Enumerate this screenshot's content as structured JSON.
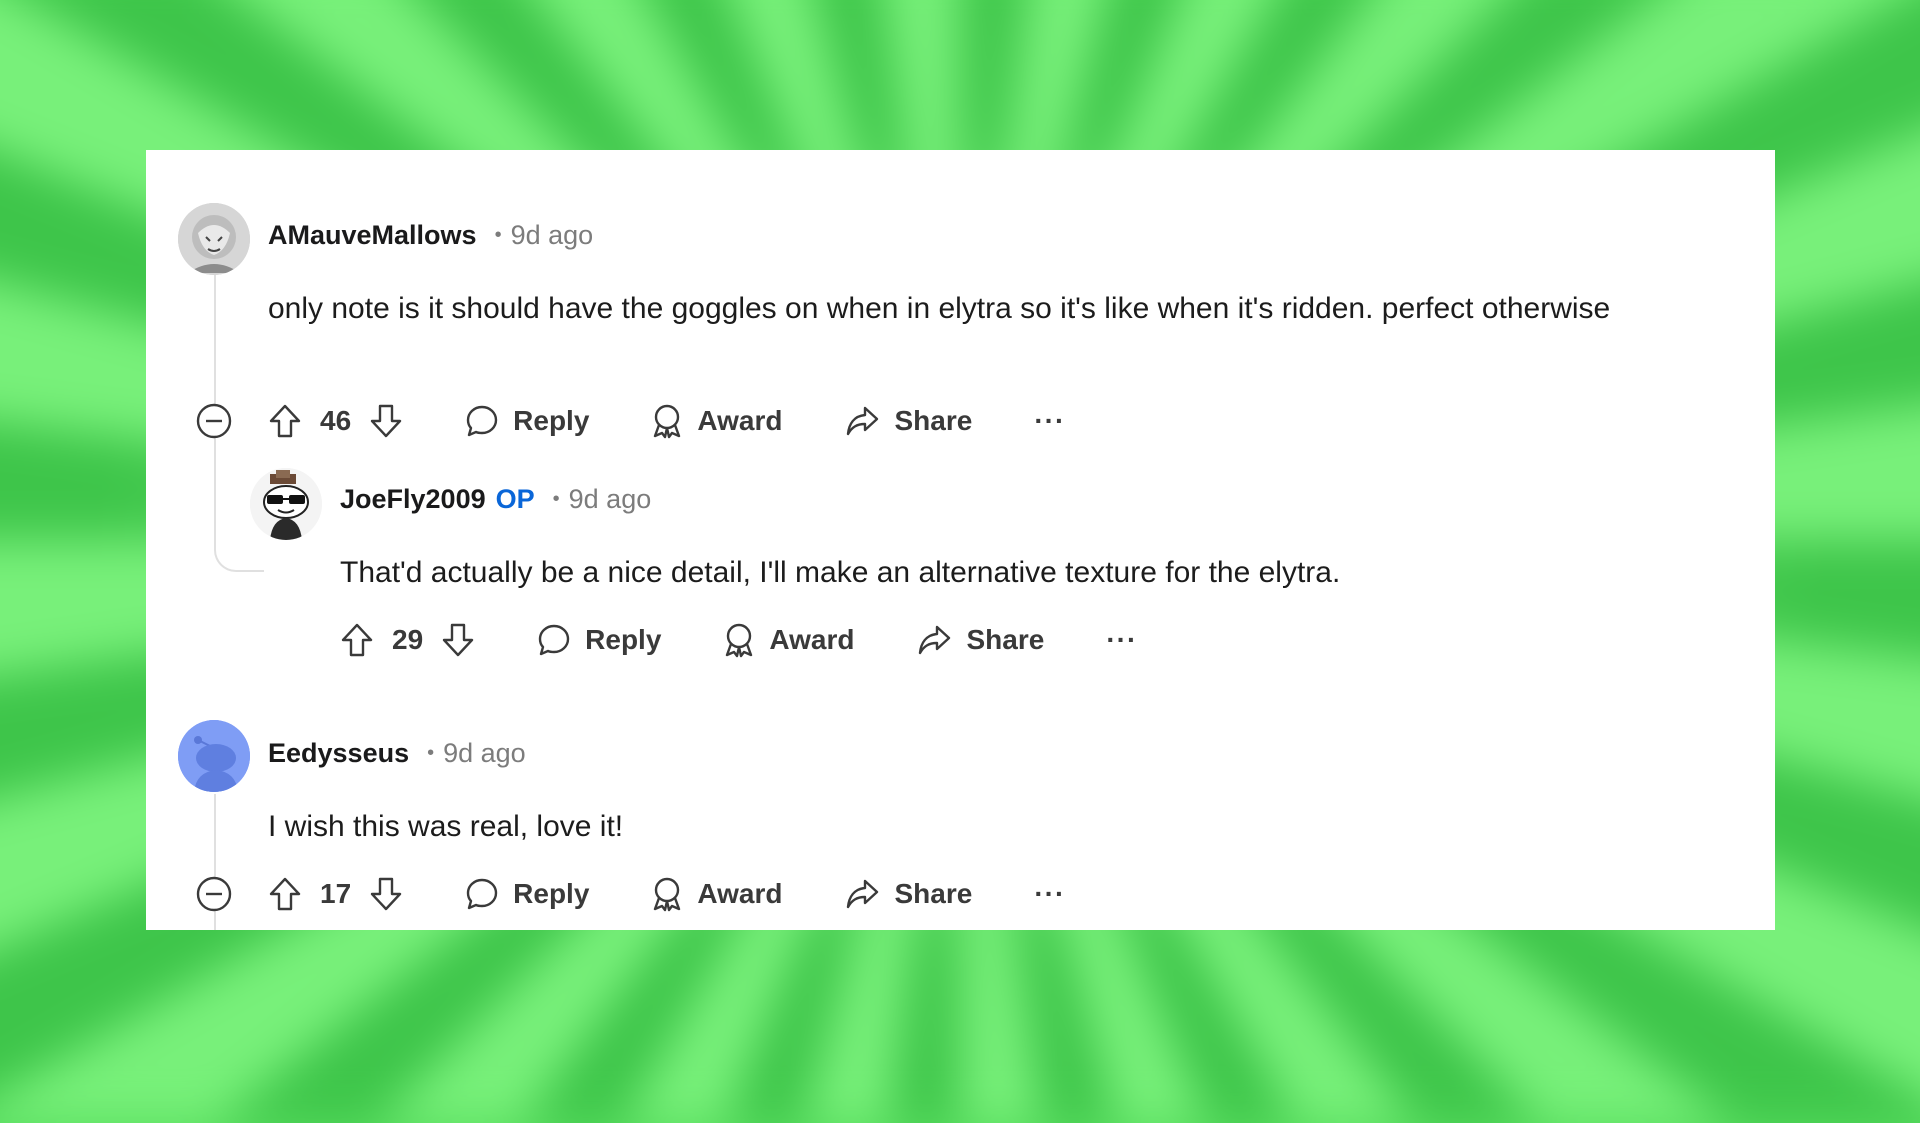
{
  "comments": [
    {
      "author": "AMauveMallows",
      "op_badge": "",
      "time": "9d ago",
      "body": "only note is it should have the goggles on when in elytra so it's like when it's ridden. perfect otherwise",
      "score": "46",
      "avatar_icon": "user-avatar-sketch",
      "collapsible": true
    },
    {
      "author": "JoeFly2009",
      "op_badge": "OP",
      "time": "9d ago",
      "body": "That'd actually be a nice detail, I'll make an alternative texture for the elytra.",
      "score": "29",
      "avatar_icon": "user-avatar-snoo-sunglasses",
      "collapsible": false
    },
    {
      "author": "Eedysseus",
      "op_badge": "",
      "time": "9d ago",
      "body": "I wish this was real, love it!",
      "score": "17",
      "avatar_icon": "user-avatar-snoo-blue",
      "collapsible": true
    }
  ],
  "actions": {
    "reply": "Reply",
    "award": "Award",
    "share": "Share",
    "more": "···"
  },
  "colors": {
    "op_badge": "#0a66d8",
    "background_green": "#57dd5e"
  }
}
